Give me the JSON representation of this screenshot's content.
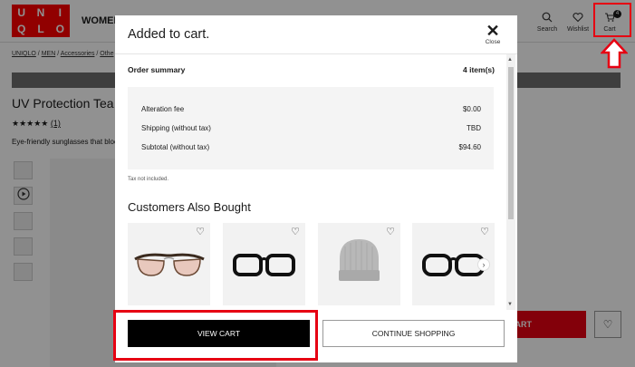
{
  "header": {
    "logo_top": [
      "U",
      "N",
      "I"
    ],
    "logo_bottom": [
      "Q",
      "L",
      "O"
    ],
    "nav_women": "WOMEN",
    "search_label": "Search",
    "wishlist_label": "Wishlist",
    "cart_label": "Cart",
    "cart_count": "4"
  },
  "breadcrumb": {
    "uniqlo": "UNIQLO",
    "men": "MEN",
    "accessories": "Accessories",
    "other": "Othe"
  },
  "product": {
    "title": "UV Protection Tea",
    "stars": "★★★★★",
    "review_count": "(1)",
    "description": "Eye-friendly sunglasses that bloc",
    "add_to_cart": "ART"
  },
  "modal": {
    "title": "Added to cart.",
    "close_label": "Close",
    "summary_title": "Order summary",
    "item_count": "4 item(s)",
    "rows": [
      {
        "label": "Alteration fee",
        "value": "$0.00"
      },
      {
        "label": "Shipping (without tax)",
        "value": "TBD"
      },
      {
        "label": "Subtotal (without tax)",
        "value": "$94.60"
      }
    ],
    "tax_note": "Tax not included.",
    "also_bought_title": "Customers Also Bought",
    "view_cart": "VIEW CART",
    "continue_shopping": "CONTINUE SHOPPING"
  },
  "colors": {
    "brand_red": "#ff0000",
    "highlight_red": "#e60012",
    "primary_button": "#000000"
  },
  "icons": {
    "search": "search-icon",
    "wishlist": "heart-icon",
    "cart": "cart-icon",
    "close": "close-icon"
  }
}
